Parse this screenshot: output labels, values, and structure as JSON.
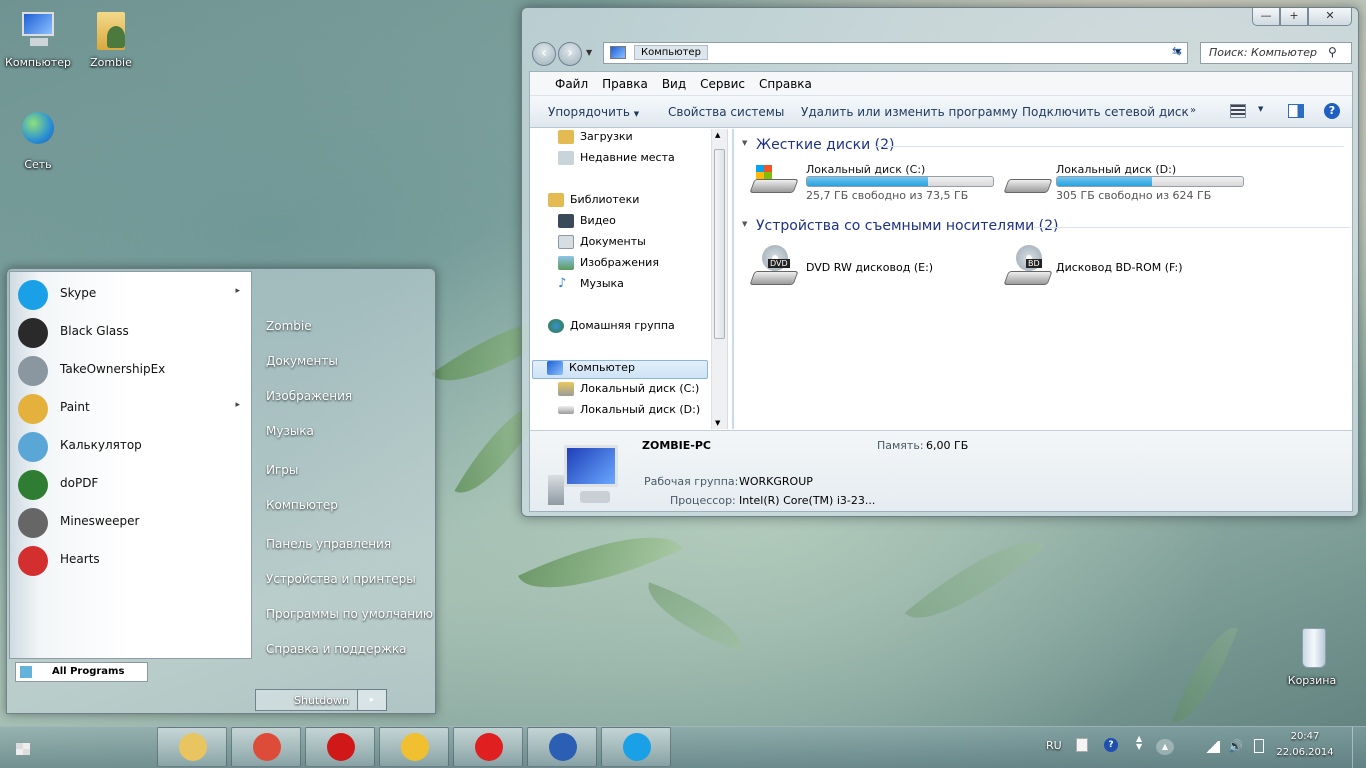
{
  "desktop": {
    "icons": [
      {
        "label": "Компьютер"
      },
      {
        "label": "Zombie"
      },
      {
        "label": "Сеть"
      },
      {
        "label": "Корзина"
      }
    ]
  },
  "explorer": {
    "breadcrumb": "Компьютер",
    "search_placeholder": "Поиск: Компьютер",
    "menu": [
      "Файл",
      "Правка",
      "Вид",
      "Сервис",
      "Справка"
    ],
    "commands": [
      "Упорядочить",
      "Свойства системы",
      "Удалить или изменить программу",
      "Подключить сетевой диск"
    ],
    "nav": [
      {
        "label": "Загрузки"
      },
      {
        "label": "Недавние места"
      },
      {
        "label": "Библиотеки"
      },
      {
        "label": "Видео"
      },
      {
        "label": "Документы"
      },
      {
        "label": "Изображения"
      },
      {
        "label": "Музыка"
      },
      {
        "label": "Домашняя группа"
      },
      {
        "label": "Компьютер"
      },
      {
        "label": "Локальный диск (C:)"
      },
      {
        "label": "Локальный диск (D:)"
      }
    ],
    "groups": {
      "hdd": "Жесткие диски (2)",
      "removable": "Устройства со съемными носителями (2)"
    },
    "drives": [
      {
        "name": "Локальный диск (C:)",
        "free_text": "25,7 ГБ свободно из 73,5 ГБ",
        "used_fraction": 0.65
      },
      {
        "name": "Локальный диск (D:)",
        "free_text": "305 ГБ свободно из 624 ГБ",
        "used_fraction": 0.51
      }
    ],
    "removable": [
      {
        "name": "DVD RW дисковод (E:)",
        "badge": "DVD"
      },
      {
        "name": "Дисковод BD-ROM (F:)",
        "badge": "BD"
      }
    ],
    "details": {
      "pc_name": "ZOMBIE-PC",
      "memory_label": "Память:",
      "memory_value": "6,00 ГБ",
      "workgroup_label": "Рабочая группа:",
      "workgroup_value": "WORKGROUP",
      "cpu_label": "Процессор:",
      "cpu_value": "Intel(R) Core(TM) i3-23..."
    }
  },
  "start_menu": {
    "programs": [
      {
        "label": "Skype",
        "has_submenu": true,
        "color": "#1aa0e6"
      },
      {
        "label": "Black Glass",
        "has_submenu": false,
        "color": "#2a2a2a"
      },
      {
        "label": "TakeOwnershipEx",
        "has_submenu": false,
        "color": "#8a96a0"
      },
      {
        "label": "Paint",
        "has_submenu": true,
        "color": "#e4b13c"
      },
      {
        "label": "Калькулятор",
        "has_submenu": false,
        "color": "#5aa6d6"
      },
      {
        "label": "doPDF",
        "has_submenu": false,
        "color": "#2e7d32"
      },
      {
        "label": "Minesweeper",
        "has_submenu": false,
        "color": "#666666"
      },
      {
        "label": "Hearts",
        "has_submenu": false,
        "color": "#d32f2f"
      }
    ],
    "places": [
      "Zombie",
      "Документы",
      "Изображения",
      "Музыка",
      "Игры",
      "Компьютер",
      "Панель управления",
      "Устройства и принтеры",
      "Программы по умолчанию",
      "Справка и поддержка"
    ],
    "all_programs": "All Programs",
    "shutdown": "Shutdown"
  },
  "taskbar": {
    "pinned": [
      {
        "name": "explorer",
        "color": "#e8c560"
      },
      {
        "name": "chrome",
        "color": "#dd4b39"
      },
      {
        "name": "opera",
        "color": "#d01818"
      },
      {
        "name": "paint",
        "color": "#f0c030"
      },
      {
        "name": "yandex",
        "color": "#e02020"
      },
      {
        "name": "word",
        "color": "#2b5fb4"
      },
      {
        "name": "skype",
        "color": "#1aa0e6"
      }
    ],
    "lang": "RU",
    "time": "20:47",
    "date": "22.06.2014"
  }
}
